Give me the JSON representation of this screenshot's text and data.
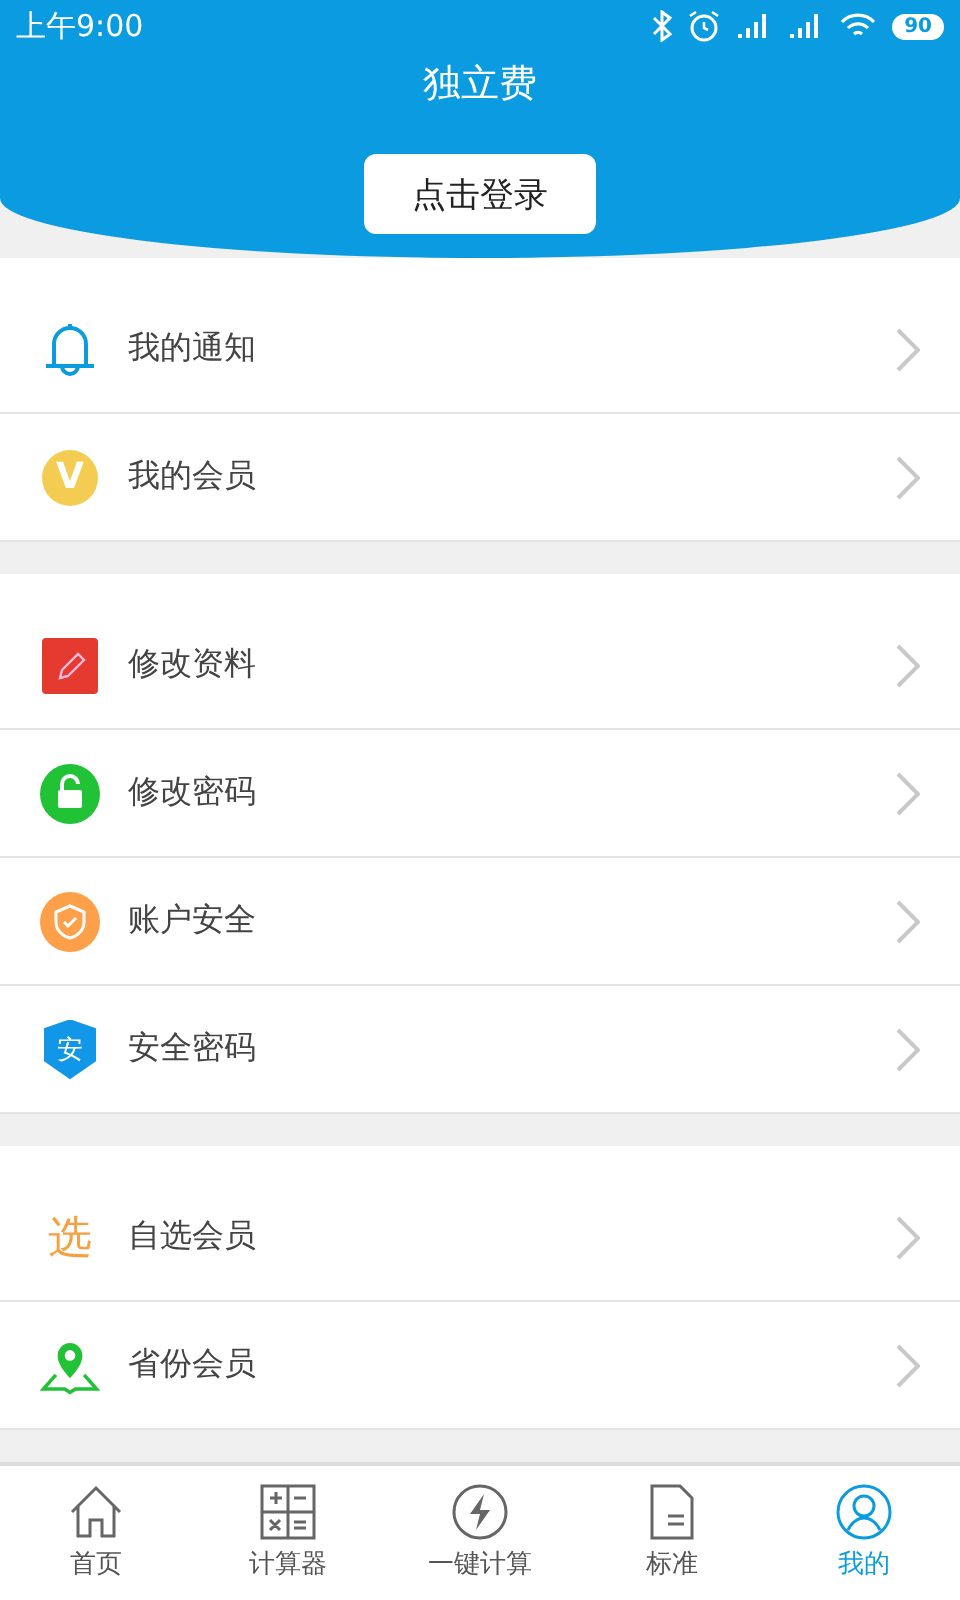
{
  "status_bar": {
    "time": "上午9:00",
    "battery": "90"
  },
  "header": {
    "title": "独立费",
    "login_button": "点击登录"
  },
  "groups": [
    {
      "items": [
        {
          "label": "我的通知",
          "kind": "bell"
        },
        {
          "label": "我的会员",
          "kind": "vip",
          "glyph": "V"
        }
      ]
    },
    {
      "items": [
        {
          "label": "修改资料",
          "kind": "edit"
        },
        {
          "label": "修改密码",
          "kind": "lock"
        },
        {
          "label": "账户安全",
          "kind": "shield"
        },
        {
          "label": "安全密码",
          "kind": "badge",
          "glyph": "安"
        }
      ]
    },
    {
      "items": [
        {
          "label": "自选会员",
          "kind": "char",
          "glyph": "选"
        },
        {
          "label": "省份会员",
          "kind": "pin"
        }
      ]
    }
  ],
  "tabs": [
    {
      "label": "首页",
      "kind": "home",
      "selected": false
    },
    {
      "label": "计算器",
      "kind": "calc",
      "selected": false
    },
    {
      "label": "一键计算",
      "kind": "bolt",
      "selected": false
    },
    {
      "label": "标准",
      "kind": "doc",
      "selected": false
    },
    {
      "label": "我的",
      "kind": "user",
      "selected": true
    }
  ]
}
